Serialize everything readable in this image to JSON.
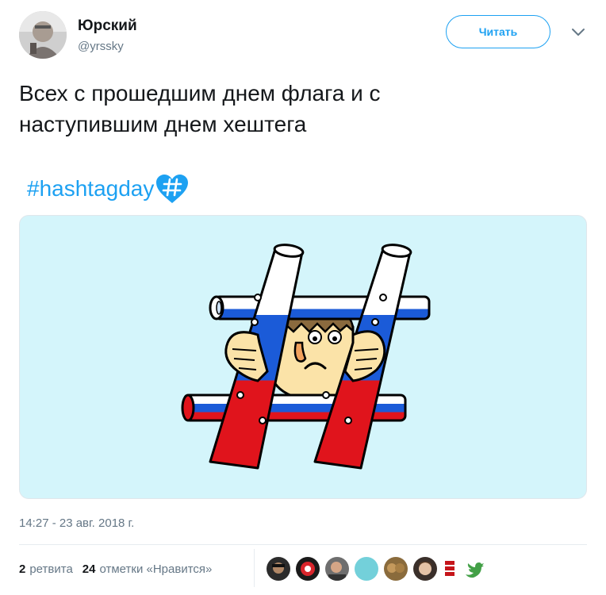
{
  "user": {
    "name": "Юрский",
    "handle": "@yrssky"
  },
  "follow_button": {
    "label": "Читать"
  },
  "tweet": {
    "text_line1": "Всех с прошедшим днем флага и с",
    "text_line2": "наступившим днем хештега",
    "hashtag": "#hashtagday"
  },
  "meta": {
    "timestamp": "14:27 - 23 авг. 2018 г."
  },
  "stats": {
    "retweets_count": "2",
    "retweets_label": "ретвита",
    "likes_count": "24",
    "likes_label": "отметки «Нравится»"
  },
  "colors": {
    "accent": "#1da1f2",
    "media_bg": "#d4f5fb",
    "flag_white": "#ffffff",
    "flag_blue": "#1b5bd8",
    "flag_red": "#e0141c"
  },
  "icons": {
    "menu": "chevron-down-icon",
    "hashtag_emoji": "blue-heart-hash-icon"
  }
}
